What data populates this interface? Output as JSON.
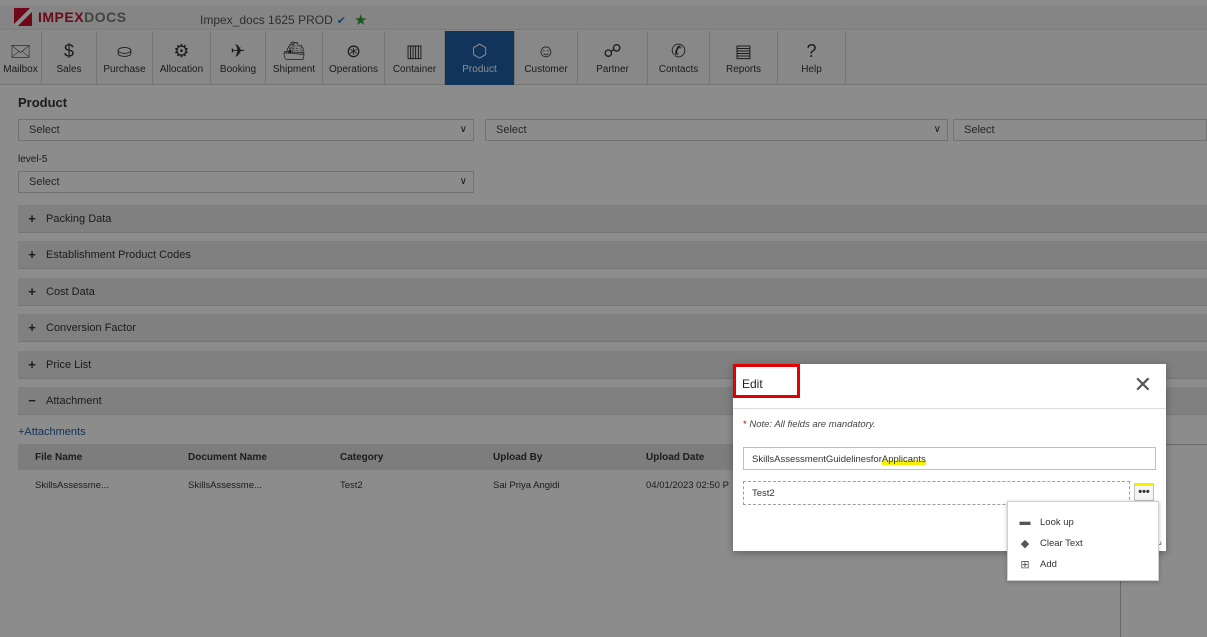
{
  "brand": {
    "part1": "IMPEX",
    "part2": "DOCS"
  },
  "env": {
    "label": "Impex_docs 1625 PROD"
  },
  "nav": [
    {
      "label": "Mailbox",
      "icon": "🖂"
    },
    {
      "label": "Sales",
      "icon": "$"
    },
    {
      "label": "Purchase",
      "icon": "⛀"
    },
    {
      "label": "Allocation",
      "icon": "⚙"
    },
    {
      "label": "Booking",
      "icon": "✈"
    },
    {
      "label": "Shipment",
      "icon": "⛴"
    },
    {
      "label": "Operations",
      "icon": "⊛"
    },
    {
      "label": "Container",
      "icon": "▥"
    },
    {
      "label": "Product",
      "icon": "⬡"
    },
    {
      "label": "Customer",
      "icon": "☺"
    },
    {
      "label": "Partner",
      "icon": "☍"
    },
    {
      "label": "Contacts",
      "icon": "✆"
    },
    {
      "label": "Reports",
      "icon": "▤"
    },
    {
      "label": "Help",
      "icon": "?"
    }
  ],
  "page": {
    "title": "Product",
    "select1": "Select",
    "select2": "Select",
    "select3": "Select",
    "level_label": "level-5",
    "select4": "Select"
  },
  "sections": [
    {
      "label": "Packing Data",
      "sign": "+"
    },
    {
      "label": "Establishment Product Codes",
      "sign": "+"
    },
    {
      "label": "Cost Data",
      "sign": "+"
    },
    {
      "label": "Conversion Factor",
      "sign": "+"
    },
    {
      "label": "Price List",
      "sign": "+"
    },
    {
      "label": "Attachment",
      "sign": "−"
    }
  ],
  "attachments": {
    "link": "+Attachments",
    "columns": [
      "File Name",
      "Document Name",
      "Category",
      "Upload By",
      "Upload Date"
    ],
    "row": [
      "SkillsAssessme...",
      "SkillsAssessme...",
      "Test2",
      "Sai Priya Angidi",
      "04/01/2023 02:50 P"
    ]
  },
  "modal": {
    "title": "Edit",
    "note_star": "*",
    "note": "Note: All fields are mandatory.",
    "doc_name_a": "SkillsAssessmentGuidelinesfor",
    "doc_name_b": "Applicants",
    "category_value": "Test2",
    "more_label": "•••"
  },
  "menu": {
    "lookup": "Look up",
    "clear": "Clear Text",
    "add": "Add"
  },
  "colors": {
    "brand": "#c8102e",
    "active_nav": "#1f5fa6",
    "highlight": "#e30000"
  }
}
